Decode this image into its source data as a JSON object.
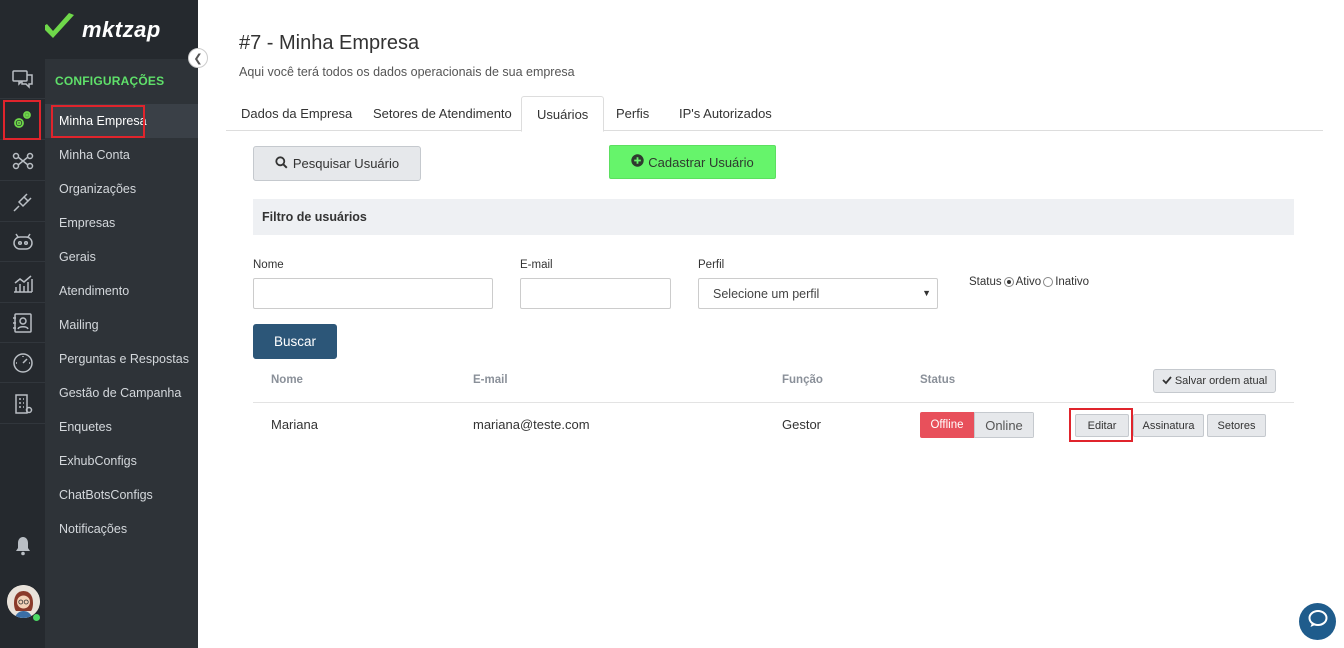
{
  "app": {
    "logo_text": "mktzap"
  },
  "menu": {
    "heading": "CONFIGURAÇÕES",
    "items": [
      {
        "label": "Minha Empresa",
        "active": true
      },
      {
        "label": "Minha Conta"
      },
      {
        "label": "Organizações"
      },
      {
        "label": "Empresas"
      },
      {
        "label": "Gerais"
      },
      {
        "label": "Atendimento"
      },
      {
        "label": "Mailing"
      },
      {
        "label": "Perguntas e Respostas"
      },
      {
        "label": "Gestão de Campanha"
      },
      {
        "label": "Enquetes"
      },
      {
        "label": "ExhubConfigs"
      },
      {
        "label": "ChatBotsConfigs"
      },
      {
        "label": "Notificações"
      }
    ]
  },
  "page": {
    "title": "#7 - Minha Empresa",
    "subtitle": "Aqui você terá todos os dados operacionais de sua empresa"
  },
  "tabs": [
    {
      "label": "Dados da Empresa"
    },
    {
      "label": "Setores de Atendimento"
    },
    {
      "label": "Usuários",
      "active": true
    },
    {
      "label": "Perfis"
    },
    {
      "label": "IP's Autorizados"
    }
  ],
  "actions": {
    "search_label": "Pesquisar Usuário",
    "register_label": "Cadastrar Usuário"
  },
  "filter": {
    "heading": "Filtro de usuários",
    "name_label": "Nome",
    "name_value": "",
    "email_label": "E-mail",
    "email_value": "",
    "profile_label": "Perfil",
    "profile_selected": "Selecione um perfil",
    "status_label": "Status",
    "status_active": "Ativo",
    "status_inactive": "Inativo",
    "search_button": "Buscar"
  },
  "table": {
    "headers": {
      "name": "Nome",
      "email": "E-mail",
      "role": "Função",
      "status": "Status"
    },
    "save_order_label": "Salvar ordem atual",
    "rows": [
      {
        "name": "Mariana",
        "email": "mariana@teste.com",
        "role": "Gestor",
        "status_offline": "Offline",
        "status_online": "Online",
        "edit": "Editar",
        "signature": "Assinatura",
        "sectors": "Setores"
      }
    ]
  },
  "colors": {
    "rail_bg": "#25292e",
    "menu_bg": "#2e3338",
    "heading_green": "#5fe06a",
    "register_green": "#66f46b",
    "primary_blue": "#2c5678",
    "offline_red": "#e8505b",
    "highlight_red": "#e0242c"
  }
}
